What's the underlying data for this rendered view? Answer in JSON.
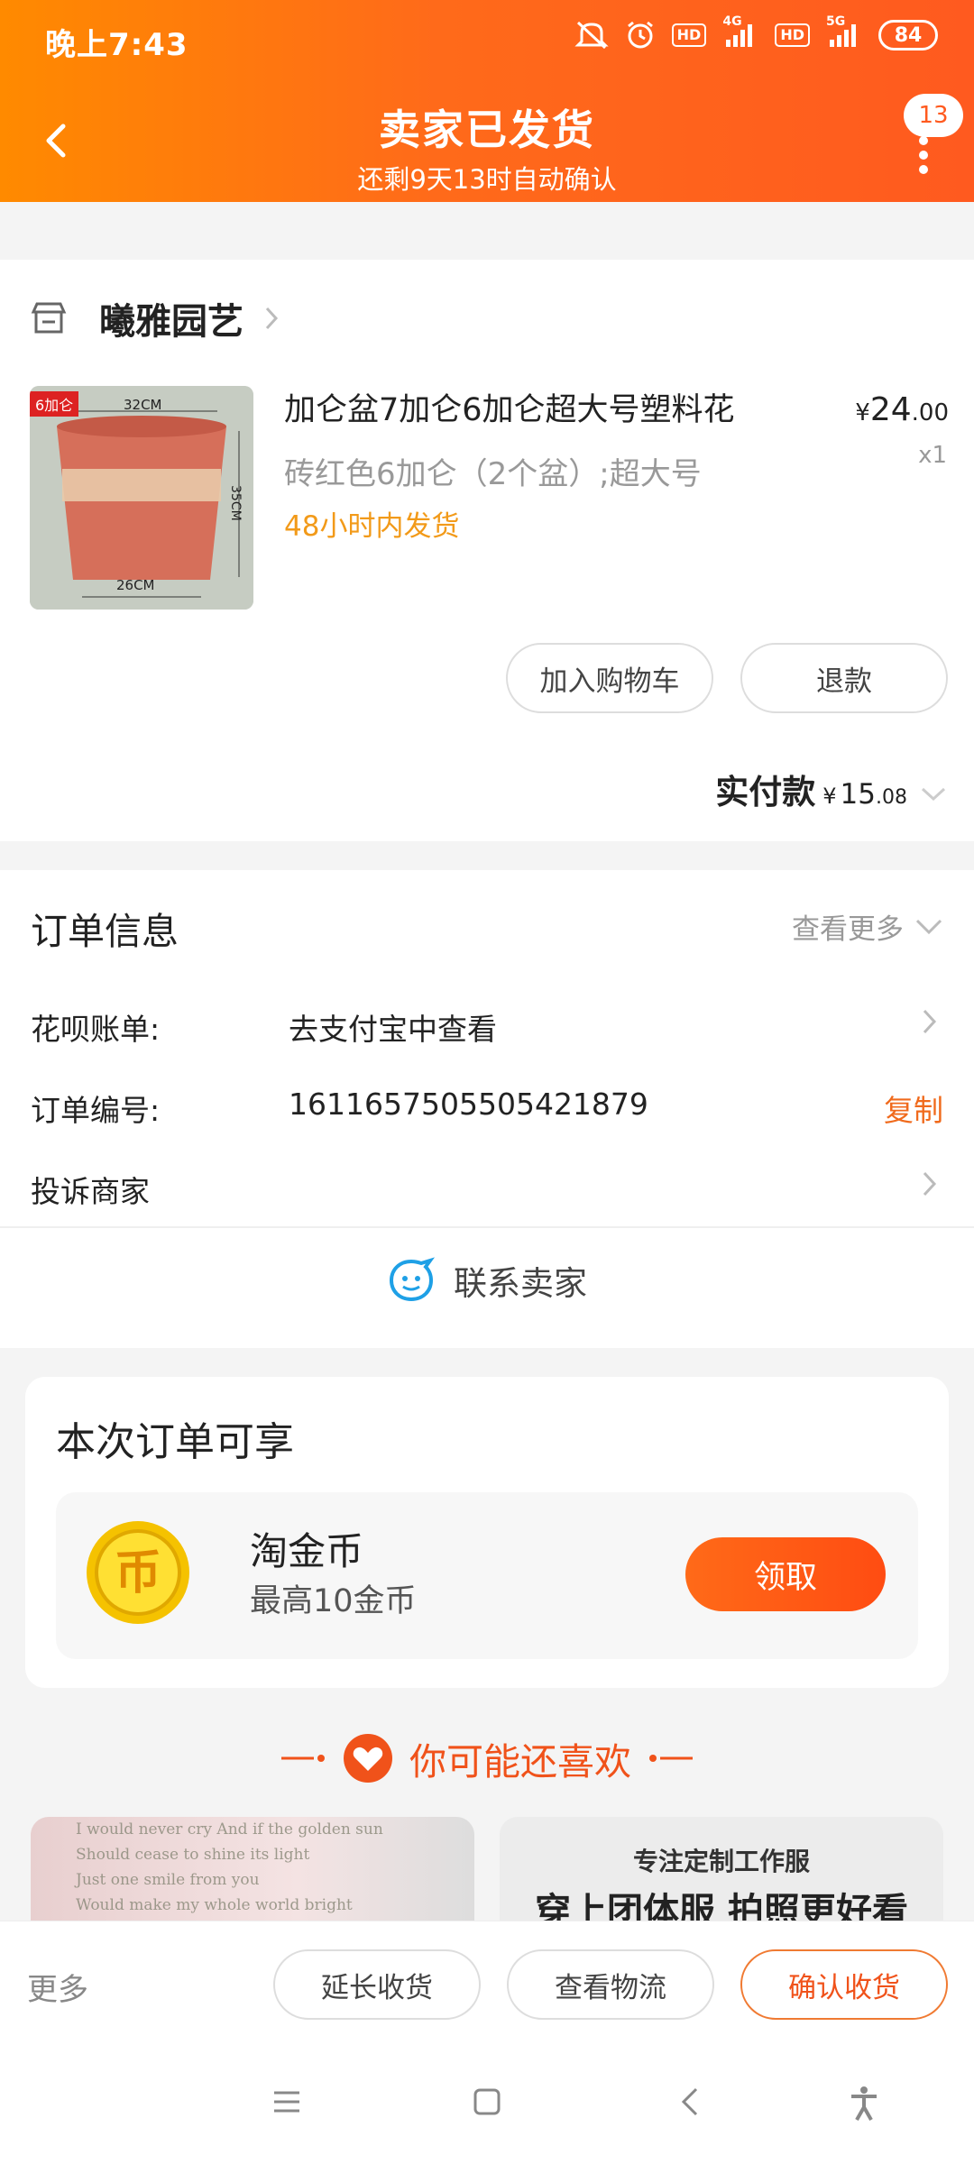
{
  "status_bar": {
    "time": "晚上7:43",
    "net1": "4G",
    "net2": "5G",
    "hd": "HD",
    "battery": "84"
  },
  "header": {
    "title": "卖家已发货",
    "subtitle": "还剩9天13时自动确认",
    "badge": "13"
  },
  "shop": {
    "name": "曦雅园艺",
    "product": {
      "tag": "6加仑",
      "dim_top": "32CM",
      "dim_side": "35CM",
      "dim_bottom": "26CM",
      "title": "加仑盆7加仑6加仑超大号塑料花",
      "sku": "砖红色6加仑（2个盆）;超大号",
      "shipping": "48小时内发货",
      "price_currency": "¥",
      "price_int": "24",
      "price_dec": ".00",
      "qty": "x1"
    },
    "add_cart": "加入购物车",
    "refund": "退款",
    "paid_label": "实付款",
    "paid_currency": "¥",
    "paid_int": "15",
    "paid_dec": ".08"
  },
  "order_info": {
    "title": "订单信息",
    "see_more": "查看更多",
    "rows": [
      {
        "label": "花呗账单:",
        "value": "去支付宝中查看"
      },
      {
        "label": "订单编号:",
        "value": "1611657505505421879",
        "action": "复制"
      },
      {
        "label": "投诉商家",
        "value": ""
      }
    ],
    "contact": "联系卖家"
  },
  "benefits": {
    "title": "本次订单可享",
    "coin_title": "淘金币",
    "coin_sub": "最高10金币",
    "claim": "领取"
  },
  "recommend": {
    "title": "你可能还喜欢",
    "left_lines": [
      "I would never cry And if the golden sun",
      "Should cease to shine its light",
      "Just one smile from you",
      "Would make my whole world bright"
    ],
    "right_line1": "专注定制工作服",
    "right_line2": "穿上团体服 拍照更好看"
  },
  "actions": {
    "more": "更多",
    "extend": "延长收货",
    "logistics": "查看物流",
    "confirm": "确认收货"
  },
  "colors": {
    "brand_orange": "#ff5a1f",
    "header_start": "#ff8a00",
    "accent_text": "#f0521a",
    "ship_text": "#f29a19"
  }
}
